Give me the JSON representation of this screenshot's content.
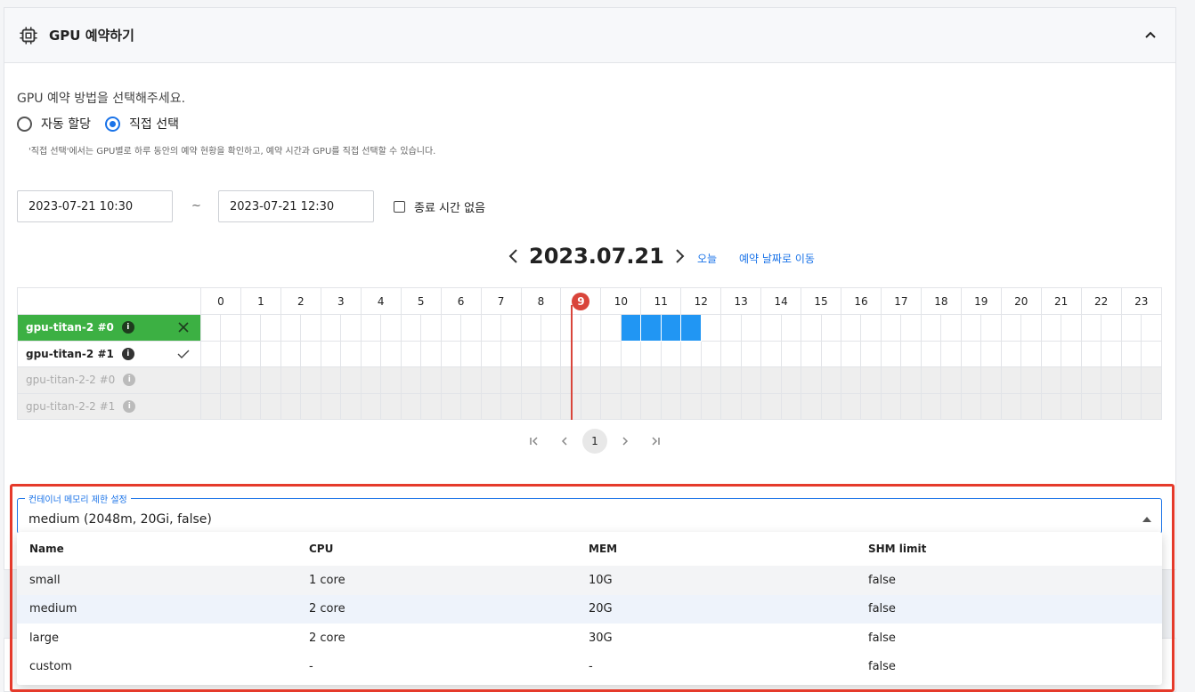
{
  "panel": {
    "title": "GPU 예약하기",
    "icon": "chip-icon",
    "collapse_icon": "chevron-up-icon"
  },
  "method": {
    "prompt": "GPU 예약 방법을 선택해주세요.",
    "options": [
      {
        "label": "자동 할당",
        "checked": false
      },
      {
        "label": "직접 선택",
        "checked": true
      }
    ],
    "note": "'직접 선택'에서는 GPU별로 하루 동안의 예약 현황을 확인하고, 예약 시간과 GPU를 직접 선택할 수 있습니다."
  },
  "range": {
    "start": "2023-07-21 10:30",
    "separator": "~",
    "end": "2023-07-21 12:30",
    "no_end_label": "종료 시간 없음",
    "no_end_checked": false
  },
  "date_nav": {
    "date": "2023.07.21",
    "today_label": "오늘",
    "goto_label": "예약 날짜로 이동"
  },
  "schedule": {
    "hours": [
      "0",
      "1",
      "2",
      "3",
      "4",
      "5",
      "6",
      "7",
      "8",
      "9",
      "10",
      "11",
      "12",
      "13",
      "14",
      "15",
      "16",
      "17",
      "18",
      "19",
      "20",
      "21",
      "22",
      "23"
    ],
    "current_hour": "9",
    "rows": [
      {
        "name": "gpu-titan-2 #0",
        "state": "selected",
        "action_icon": "close-icon"
      },
      {
        "name": "gpu-titan-2 #1",
        "state": "available",
        "action_icon": "check-icon"
      },
      {
        "name": "gpu-titan-2-2 #0",
        "state": "disabled"
      },
      {
        "name": "gpu-titan-2-2 #1",
        "state": "disabled"
      }
    ],
    "booked": {
      "row": 0,
      "start_hour": 10.5,
      "end_hour": 12.5
    },
    "colors": {
      "selected": "#3cb043",
      "booked": "#2196f3",
      "now": "#d9453b"
    }
  },
  "pager": {
    "current": "1"
  },
  "memory": {
    "legend": "컨테이너 메모리 제한 설정",
    "value": "medium (2048m, 20Gi, false)",
    "columns": [
      "Name",
      "CPU",
      "MEM",
      "SHM limit"
    ],
    "options": [
      {
        "name": "small",
        "cpu": "1 core",
        "mem": "10G",
        "shm": "false"
      },
      {
        "name": "medium",
        "cpu": "2 core",
        "mem": "20G",
        "shm": "false"
      },
      {
        "name": "large",
        "cpu": "2 core",
        "mem": "30G",
        "shm": "false"
      },
      {
        "name": "custom",
        "cpu": "-",
        "mem": "-",
        "shm": "false"
      }
    ]
  }
}
